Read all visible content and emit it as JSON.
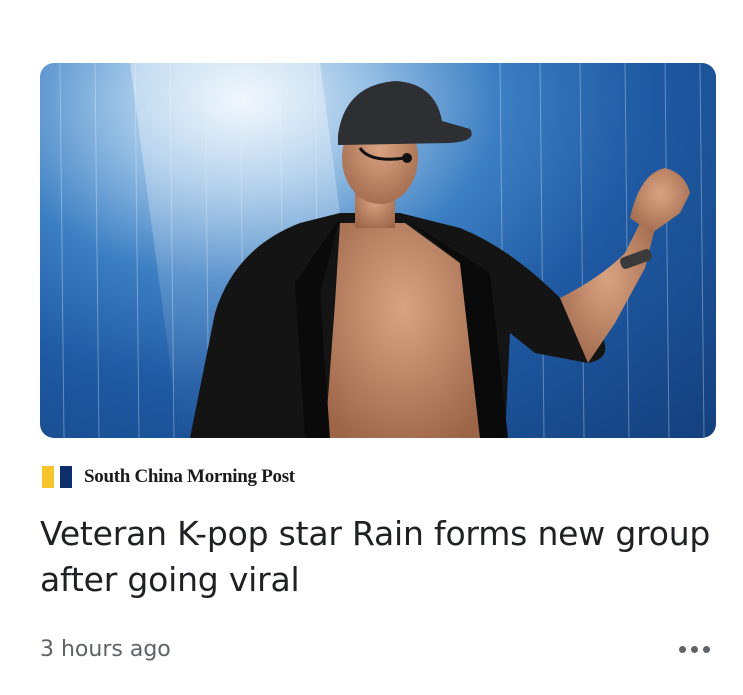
{
  "article": {
    "image_alt_icon": "news-photo",
    "source": {
      "name": "South China Morning Post",
      "logo_colors": [
        "#f6c52c",
        "#0c2f6b"
      ]
    },
    "headline": "Veteran K-pop star Rain forms new group after going viral",
    "timestamp": "3 hours ago",
    "more_icon": "more-horizontal-icon"
  },
  "colors": {
    "headline": "#202124",
    "meta": "#5f6368",
    "background": "#ffffff"
  }
}
